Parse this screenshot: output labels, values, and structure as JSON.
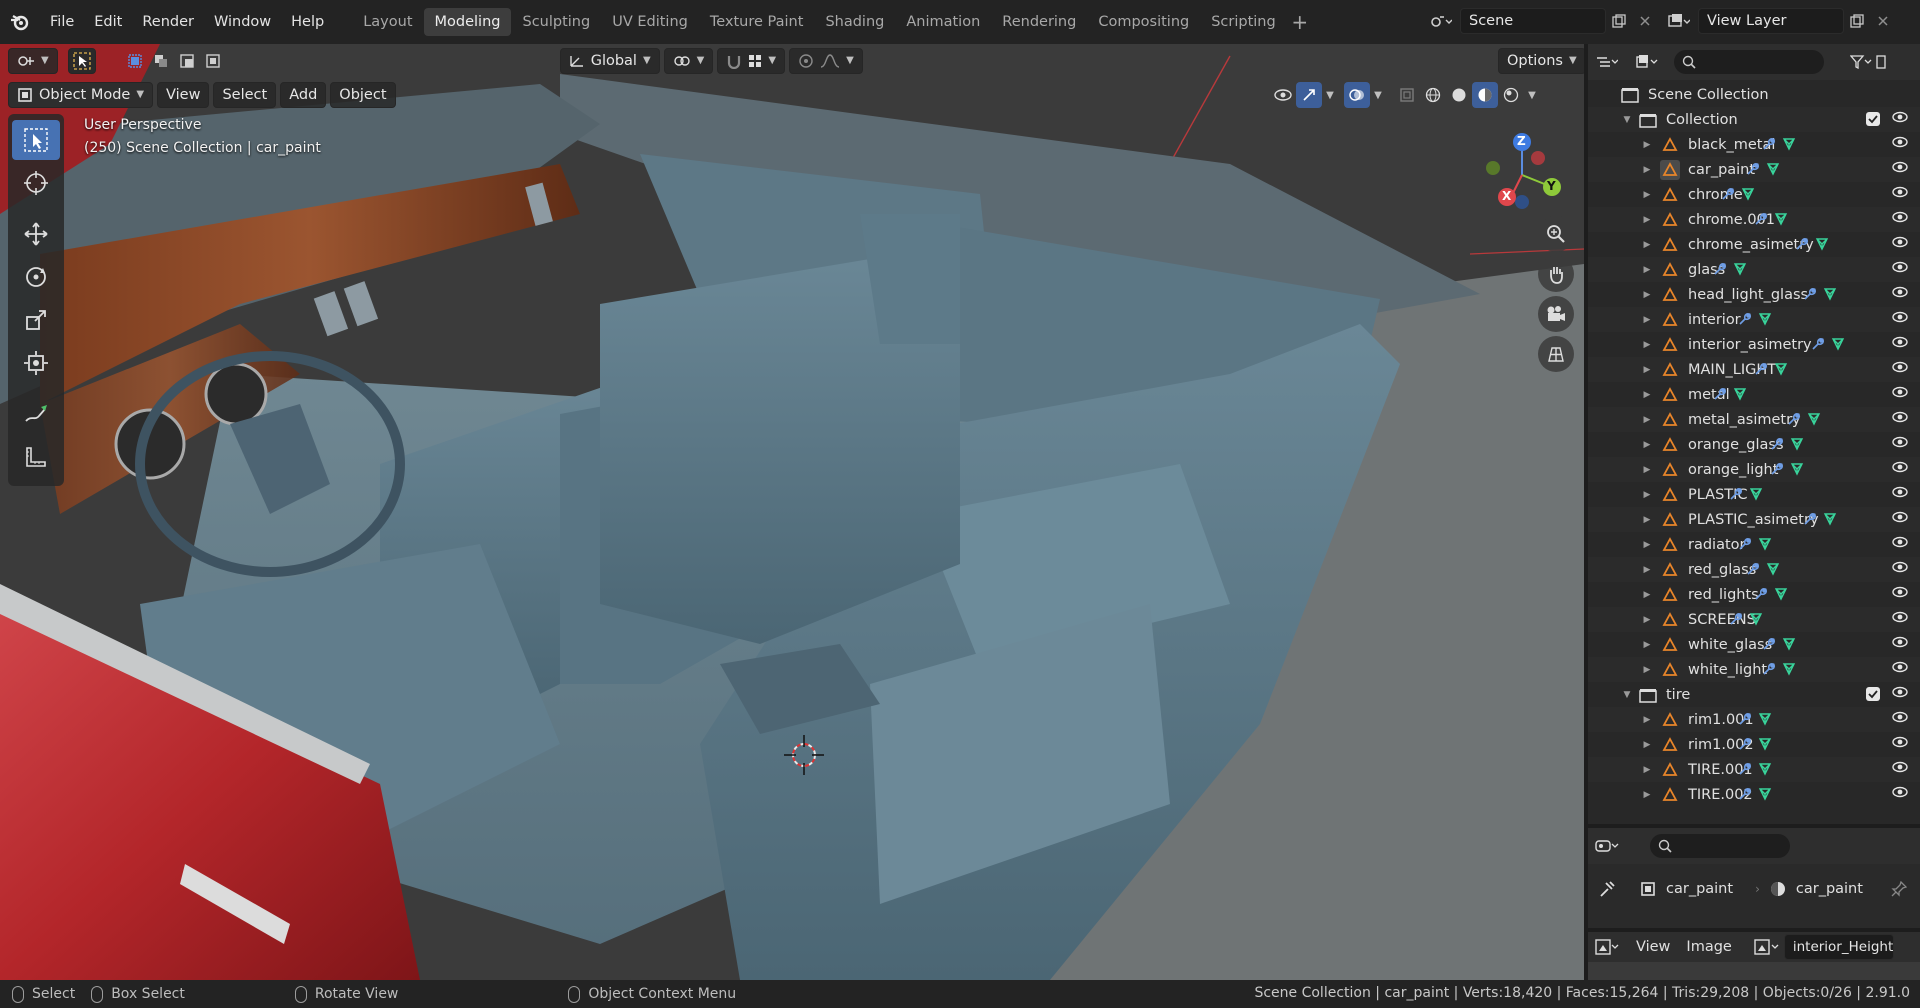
{
  "menu": {
    "items": [
      "File",
      "Edit",
      "Render",
      "Window",
      "Help"
    ]
  },
  "workspaces": {
    "tabs": [
      "Layout",
      "Modeling",
      "Sculpting",
      "UV Editing",
      "Texture Paint",
      "Shading",
      "Animation",
      "Rendering",
      "Compositing",
      "Scripting"
    ],
    "active": "Modeling"
  },
  "scene": {
    "name": "Scene"
  },
  "view_layer": {
    "name": "View Layer"
  },
  "viewport": {
    "transform_orientation": "Global",
    "options_label": "Options",
    "mode": "Object Mode",
    "header_menus": [
      "View",
      "Select",
      "Add",
      "Object"
    ],
    "overlay_line1": "User Perspective",
    "overlay_line2": "(250) Scene Collection | car_paint",
    "gizmo_axes": {
      "x": "X",
      "y": "Y",
      "z": "Z"
    }
  },
  "outliner": {
    "root": "Scene Collection",
    "collections": [
      {
        "name": "Collection",
        "objects": [
          "black_metal",
          "car_paint",
          "chrome",
          "chrome.001",
          "chrome_asimetry",
          "glass",
          "head_light_glass",
          "interior",
          "interior_asimetry",
          "MAIN_LIGHT",
          "metal",
          "metal_asimetry",
          "orange_glass",
          "orange_light",
          "PLASTIC",
          "PLASTIC_asimetry",
          "radiator",
          "red_glass",
          "red_lights",
          "SCREENS",
          "white_glass",
          "white_light"
        ]
      },
      {
        "name": "tire",
        "objects": [
          "rim1.001",
          "rim1.002",
          "TIRE.001",
          "TIRE.002"
        ]
      }
    ],
    "selected": "car_paint"
  },
  "properties": {
    "object": "car_paint",
    "material": "car_paint"
  },
  "image_editor": {
    "menus": [
      "View",
      "Image"
    ],
    "image_name": "interior_Height.p"
  },
  "statusbar": {
    "hints": [
      "Select",
      "Box Select",
      "Rotate View",
      "Object Context Menu"
    ],
    "stats": "Scene Collection | car_paint | Verts:18,420 | Faces:15,264 | Tris:29,208 | Objects:0/26 | 2.91.0"
  },
  "colors": {
    "accent": "#4772b3",
    "object_icon": "#e8852a",
    "modifier_icon": "#6f9ee6",
    "mesh_icon": "#39d39b",
    "car_red": "#b3262a",
    "interior_blue": "#5e7b8a"
  }
}
